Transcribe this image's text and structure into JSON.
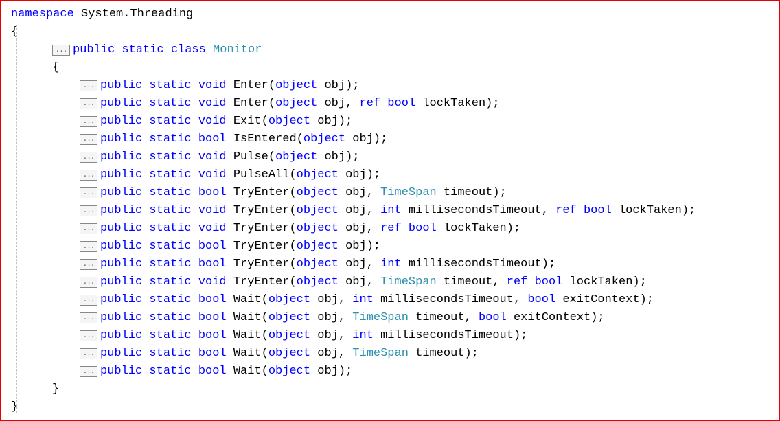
{
  "collapse_label": "...",
  "ns_line": {
    "kw1": "namespace",
    "txt": " System.Threading"
  },
  "open_brace": "{",
  "close_brace": "}",
  "class_line": {
    "kw": "public static class ",
    "type": "Monitor"
  },
  "methods": [
    {
      "pre": "public static void ",
      "name": "Enter(",
      "p": [
        {
          "kw": "object",
          "t": " obj"
        }
      ],
      "post": ");"
    },
    {
      "pre": "public static void ",
      "name": "Enter(",
      "p": [
        {
          "kw": "object",
          "t": " obj, "
        },
        {
          "kw": "ref bool",
          "t": " lockTaken"
        }
      ],
      "post": ");"
    },
    {
      "pre": "public static void ",
      "name": "Exit(",
      "p": [
        {
          "kw": "object",
          "t": " obj"
        }
      ],
      "post": ");"
    },
    {
      "pre": "public static bool ",
      "name": "IsEntered(",
      "p": [
        {
          "kw": "object",
          "t": " obj"
        }
      ],
      "post": ");"
    },
    {
      "pre": "public static void ",
      "name": "Pulse(",
      "p": [
        {
          "kw": "object",
          "t": " obj"
        }
      ],
      "post": ");"
    },
    {
      "pre": "public static void ",
      "name": "PulseAll(",
      "p": [
        {
          "kw": "object",
          "t": " obj"
        }
      ],
      "post": ");"
    },
    {
      "pre": "public static bool ",
      "name": "TryEnter(",
      "p": [
        {
          "kw": "object",
          "t": " obj, "
        },
        {
          "type": "TimeSpan",
          "t": " timeout"
        }
      ],
      "post": ");"
    },
    {
      "pre": "public static void ",
      "name": "TryEnter(",
      "p": [
        {
          "kw": "object",
          "t": " obj, "
        },
        {
          "kw": "int",
          "t": " millisecondsTimeout, "
        },
        {
          "kw": "ref bool",
          "t": " lockTaken"
        }
      ],
      "post": ");"
    },
    {
      "pre": "public static void ",
      "name": "TryEnter(",
      "p": [
        {
          "kw": "object",
          "t": " obj, "
        },
        {
          "kw": "ref bool",
          "t": " lockTaken"
        }
      ],
      "post": ");"
    },
    {
      "pre": "public static bool ",
      "name": "TryEnter(",
      "p": [
        {
          "kw": "object",
          "t": " obj"
        }
      ],
      "post": ");"
    },
    {
      "pre": "public static bool ",
      "name": "TryEnter(",
      "p": [
        {
          "kw": "object",
          "t": " obj, "
        },
        {
          "kw": "int",
          "t": " millisecondsTimeout"
        }
      ],
      "post": ");"
    },
    {
      "pre": "public static void ",
      "name": "TryEnter(",
      "p": [
        {
          "kw": "object",
          "t": " obj, "
        },
        {
          "type": "TimeSpan",
          "t": " timeout, "
        },
        {
          "kw": "ref bool",
          "t": " lockTaken"
        }
      ],
      "post": ");"
    },
    {
      "pre": "public static bool ",
      "name": "Wait(",
      "p": [
        {
          "kw": "object",
          "t": " obj, "
        },
        {
          "kw": "int",
          "t": " millisecondsTimeout, "
        },
        {
          "kw": "bool",
          "t": " exitContext"
        }
      ],
      "post": ");"
    },
    {
      "pre": "public static bool ",
      "name": "Wait(",
      "p": [
        {
          "kw": "object",
          "t": " obj, "
        },
        {
          "type": "TimeSpan",
          "t": " timeout, "
        },
        {
          "kw": "bool",
          "t": " exitContext"
        }
      ],
      "post": ");"
    },
    {
      "pre": "public static bool ",
      "name": "Wait(",
      "p": [
        {
          "kw": "object",
          "t": " obj, "
        },
        {
          "kw": "int",
          "t": " millisecondsTimeout"
        }
      ],
      "post": ");"
    },
    {
      "pre": "public static bool ",
      "name": "Wait(",
      "p": [
        {
          "kw": "object",
          "t": " obj, "
        },
        {
          "type": "TimeSpan",
          "t": " timeout"
        }
      ],
      "post": ");"
    },
    {
      "pre": "public static bool ",
      "name": "Wait(",
      "p": [
        {
          "kw": "object",
          "t": " obj"
        }
      ],
      "post": ");"
    }
  ]
}
